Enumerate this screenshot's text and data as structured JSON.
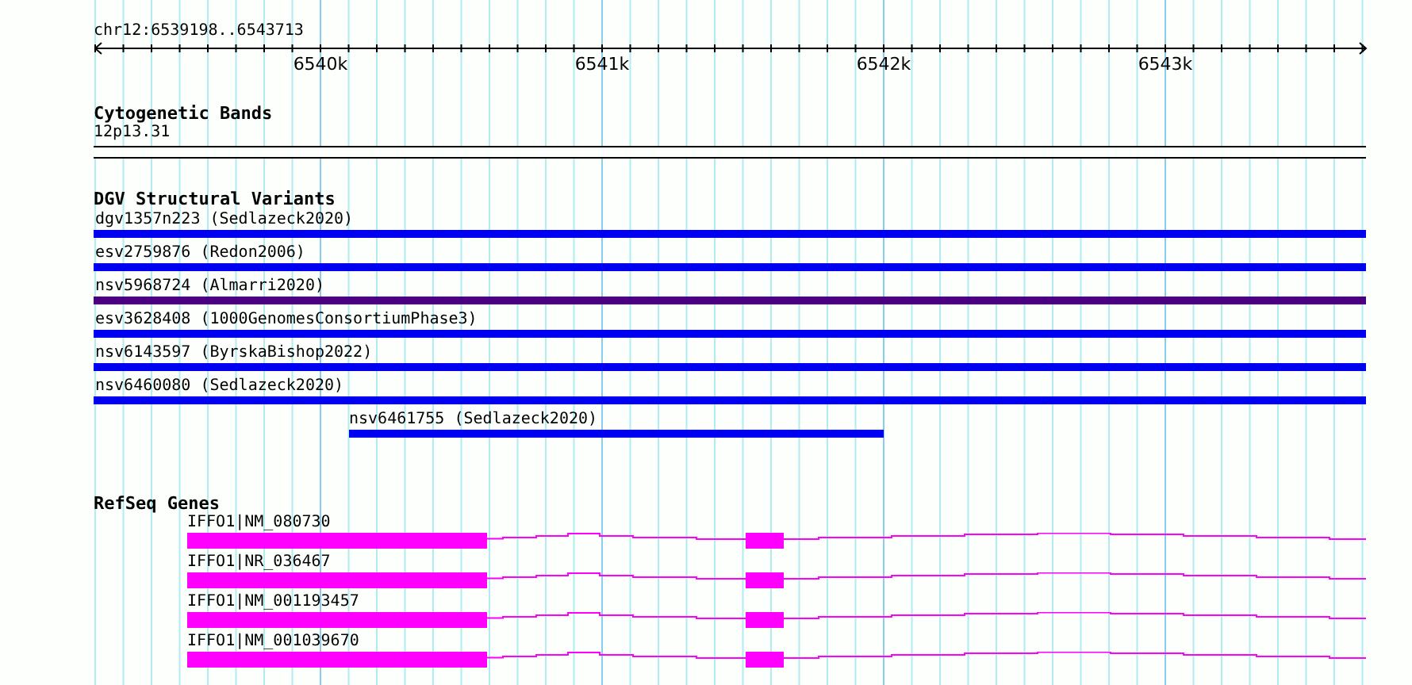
{
  "ruler": {
    "location": "chr12:6539198..6543713",
    "ticks": [
      "6540k",
      "6541k",
      "6542k",
      "6543k"
    ]
  },
  "cytogenetic_bands": {
    "title": "Cytogenetic Bands",
    "band": "12p13.31"
  },
  "structural_variants": {
    "title": "DGV Structural Variants",
    "items": [
      {
        "label": "dgv1357n223 (Sedlazeck2020)",
        "color": "#0000f0",
        "kind": "full"
      },
      {
        "label": "esv2759876 (Redon2006)",
        "color": "#0000f0",
        "kind": "full"
      },
      {
        "label": "nsv5968724 (Almarri2020)",
        "color": "#4b0082",
        "kind": "full"
      },
      {
        "label": "esv3628408 (1000GenomesConsortiumPhase3)",
        "color": "#0000f0",
        "kind": "full"
      },
      {
        "label": "nsv6143597 (ByrskaBishop2022)",
        "color": "#0000f0",
        "kind": "full"
      },
      {
        "label": "nsv6460080 (Sedlazeck2020)",
        "color": "#0000f0",
        "kind": "full"
      },
      {
        "label": "nsv6461755 (Sedlazeck2020)",
        "color": "#0000f0",
        "kind": "partial"
      }
    ]
  },
  "refseq_genes": {
    "title": "RefSeq Genes",
    "items": [
      {
        "label": "IFFO1|NM_080730"
      },
      {
        "label": "IFFO1|NR_036467"
      },
      {
        "label": "IFFO1|NM_001193457"
      },
      {
        "label": "IFFO1|NM_001039670"
      }
    ]
  }
}
